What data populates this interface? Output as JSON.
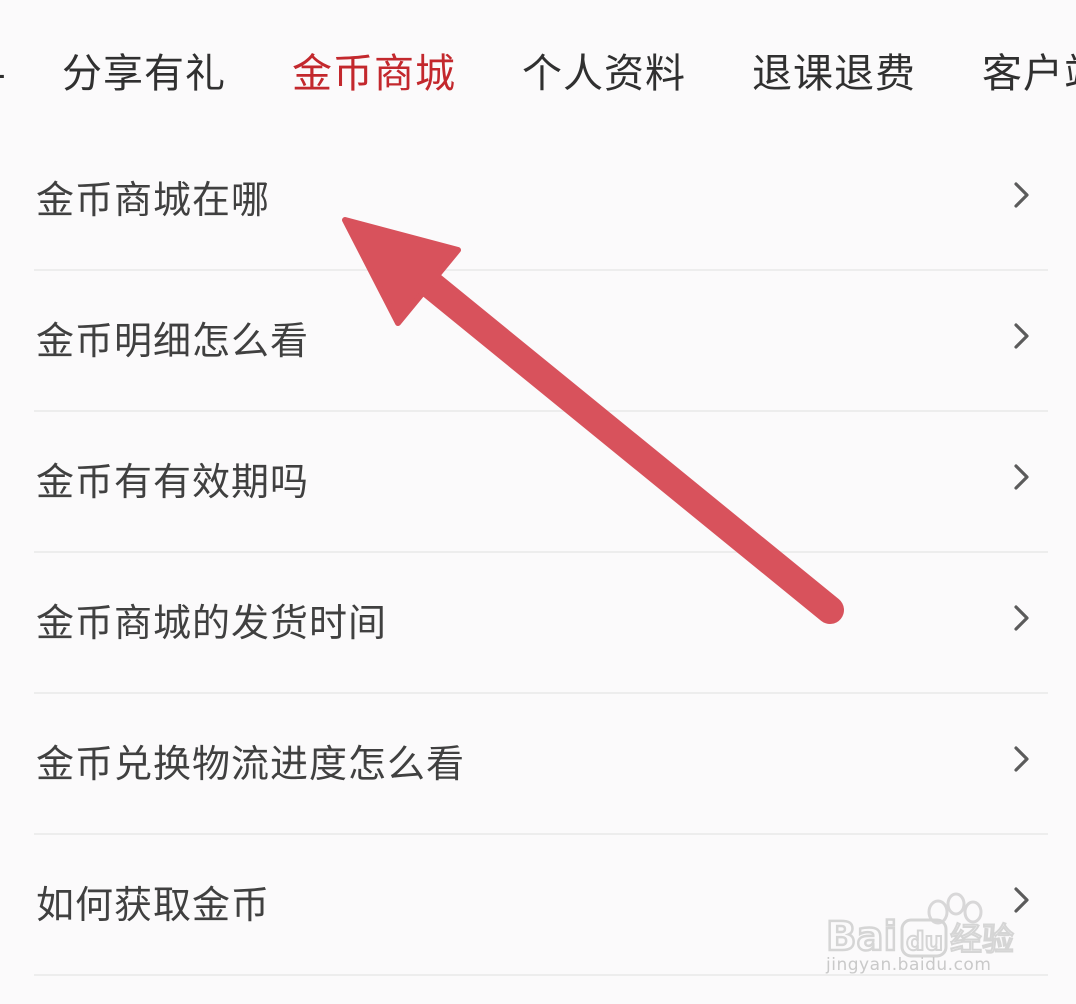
{
  "tabs": [
    {
      "label": "分享有礼",
      "active": false
    },
    {
      "label": "金币商城",
      "active": true
    },
    {
      "label": "个人资料",
      "active": false
    },
    {
      "label": "退课退费",
      "active": false
    },
    {
      "label": "客户站",
      "active": false
    }
  ],
  "faq": [
    {
      "label": "金币商城在哪"
    },
    {
      "label": "金币明细怎么看"
    },
    {
      "label": "金币有有效期吗"
    },
    {
      "label": "金币商城的发货时间"
    },
    {
      "label": "金币兑换物流进度怎么看"
    },
    {
      "label": "如何获取金币"
    }
  ],
  "colors": {
    "active_tab": "#c3282d",
    "annotation_arrow": "#d8525c"
  },
  "watermark": {
    "logo": "Bai 经验",
    "url": "jingyan.baidu.com"
  }
}
